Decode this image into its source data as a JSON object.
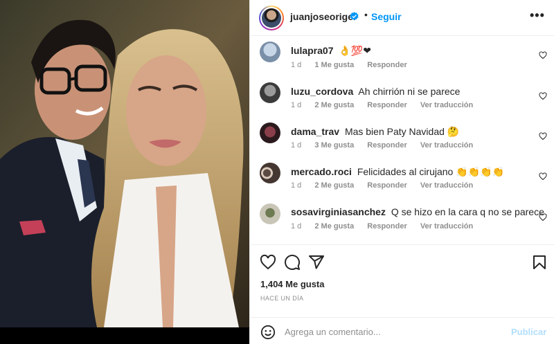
{
  "post": {
    "username": "juanjoseorigel",
    "dot": "•",
    "follow_label": "Seguir",
    "more_icon": "more-horizontal-icon",
    "verified_color": "#0095f6"
  },
  "comments": [
    {
      "user": "lulapra07",
      "text": "👌💯❤",
      "time": "1 d",
      "likes": "1 Me gusta",
      "reply": "Responder",
      "translate": ""
    },
    {
      "user": "luzu_cordova",
      "text": "Ah chirrión ni se parece",
      "time": "1 d",
      "likes": "2 Me gusta",
      "reply": "Responder",
      "translate": "Ver traducción"
    },
    {
      "user": "dama_trav",
      "text": "Mas bien Paty Navidad 🤔",
      "time": "1 d",
      "likes": "3 Me gusta",
      "reply": "Responder",
      "translate": "Ver traducción"
    },
    {
      "user": "mercado.roci",
      "text": "Felicidades al cirujano 👏👏👏👏",
      "time": "1 d",
      "likes": "2 Me gusta",
      "reply": "Responder",
      "translate": "Ver traducción"
    },
    {
      "user": "sosavirginiasanchez",
      "text": "Q se hizo en la cara q no se parece",
      "time": "1 d",
      "likes": "2 Me gusta",
      "reply": "Responder",
      "translate": "Ver traducción"
    }
  ],
  "actions": {
    "likes": "1,404 Me gusta",
    "time_ago": "HACE UN DÍA",
    "icons": [
      "heart-icon",
      "comment-icon",
      "share-icon",
      "bookmark-icon"
    ]
  },
  "add_comment": {
    "placeholder": "Agrega un comentario...",
    "publish_label": "Publicar",
    "emoji_icon": "emoji-icon"
  },
  "colors": {
    "accent": "#0095f6",
    "publish_disabled": "#b2dffc",
    "muted": "#8e8e8e"
  }
}
